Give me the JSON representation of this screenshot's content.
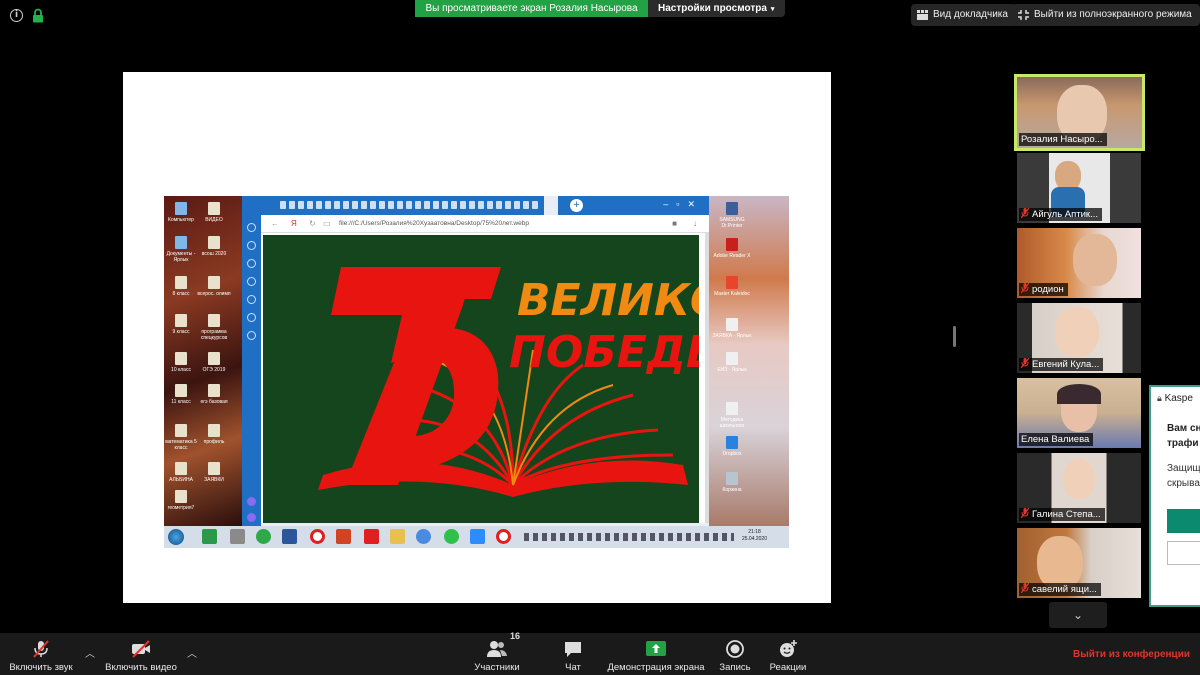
{
  "top_bar": {
    "sharing_banner": "Вы просматриваете экран Розалия Насырова",
    "view_options_label": "Настройки просмотра",
    "speaker_view_label": "Вид докладчика",
    "exit_fullscreen_label": "Выйти из полноэкранного режима"
  },
  "shared_screen": {
    "address_bar": "file:///C:/Users/Розалия%20Хузаатовна/Desktop/75%20лет.webp",
    "poster": {
      "number": "75",
      "line1": "ВЕЛИКОЙ",
      "line2": "ПОБЕДЕ"
    },
    "desktop_icons_left": [
      {
        "label": "Компьютер"
      },
      {
        "label": "ВИДЕО"
      },
      {
        "label": "Документы - Ярлык"
      },
      {
        "label": "всош 2020"
      },
      {
        "label": "8 класс"
      },
      {
        "label": "всерос. олимп"
      },
      {
        "label": "9 класс"
      },
      {
        "label": "программа спецкурсов"
      },
      {
        "label": "10 класс"
      },
      {
        "label": "ОГЭ 2019"
      },
      {
        "label": "11 класс"
      },
      {
        "label": "егэ базовая"
      },
      {
        "label": "математика 5 класс"
      },
      {
        "label": "профиль"
      },
      {
        "label": "АЛЬБИНА"
      },
      {
        "label": "ЗАЯВКИ"
      },
      {
        "label": "геометрия7"
      }
    ],
    "desktop_icons_right": [
      {
        "label": "SAMSUNG Dr.Printer"
      },
      {
        "label": "Adobe Reader X"
      },
      {
        "label": "Master Kaleidoc"
      },
      {
        "label": "ЗАЯВКА - Ярлык"
      },
      {
        "label": "ЕИЗ - Ярлык"
      },
      {
        "label": "Методика школьного"
      },
      {
        "label": "Dropbox"
      },
      {
        "label": "Корзина"
      }
    ],
    "clock": {
      "time": "21:18",
      "date": "25.04.2020"
    }
  },
  "participants": [
    {
      "name": "Розалия Насыро...",
      "muted": false,
      "active": true
    },
    {
      "name": "Айгуль Аптик...",
      "muted": true,
      "active": false
    },
    {
      "name": "родион",
      "muted": true,
      "active": false
    },
    {
      "name": "Евгений Кула...",
      "muted": true,
      "active": false
    },
    {
      "name": "Елена Валиева",
      "muted": false,
      "active": false
    },
    {
      "name": "Галина Степа...",
      "muted": true,
      "active": false
    },
    {
      "name": "савелий ящи...",
      "muted": true,
      "active": false
    }
  ],
  "popup": {
    "app": "Kaspe",
    "title_line1": "Вам сн",
    "title_line2": "трафи",
    "text_line1": "Защищ",
    "text_line2": "скрыва"
  },
  "toolbar": {
    "unmute_label": "Включить звук",
    "start_video_label": "Включить видео",
    "participants_label": "Участники",
    "participants_count": "16",
    "chat_label": "Чат",
    "share_label": "Демонстрация экрана",
    "record_label": "Запись",
    "reactions_label": "Реакции",
    "leave_label": "Выйти из конференции"
  },
  "colors": {
    "sharing_green": "#23a245",
    "active_speaker_border": "#c7e86a",
    "leave_red": "#e0352b",
    "poster_red": "#e8140f",
    "poster_orange": "#f08a12",
    "poster_green": "#14451c"
  }
}
